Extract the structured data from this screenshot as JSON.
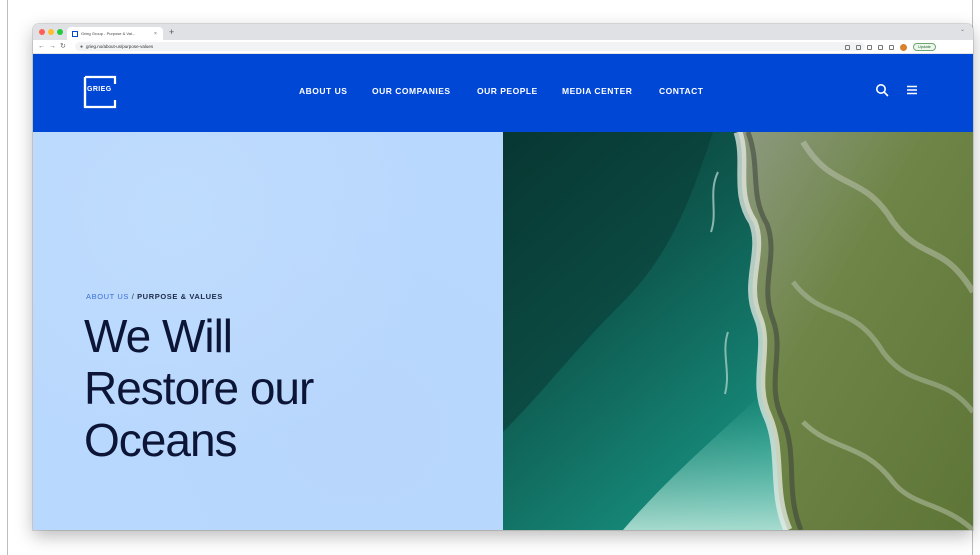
{
  "browser": {
    "tab_title": "Grieg Group - Purpose & Val...",
    "tab_close": "×",
    "new_tab": "+",
    "url": "grieg.no/about-us/purpose-values",
    "update_label": "Update"
  },
  "header": {
    "logo_text": "GRIEG",
    "nav": [
      {
        "label": "ABOUT US"
      },
      {
        "label": "OUR COMPANIES"
      },
      {
        "label": "OUR PEOPLE"
      },
      {
        "label": "MEDIA CENTER"
      },
      {
        "label": "CONTACT"
      }
    ]
  },
  "hero": {
    "breadcrumb_link": "ABOUT US",
    "breadcrumb_sep": " / ",
    "breadcrumb_current": "PURPOSE & VALUES",
    "title_lines": [
      "We Will",
      "Restore our",
      "Oceans"
    ]
  },
  "colors": {
    "brand_blue": "#0047d6",
    "hero_bg": "#b9d8fd",
    "title_text": "#0c1536",
    "breadcrumb_link": "#3a6fd8"
  },
  "icons": {
    "search": "search-icon",
    "menu": "hamburger-menu-icon",
    "logo": "grieg-logo"
  }
}
